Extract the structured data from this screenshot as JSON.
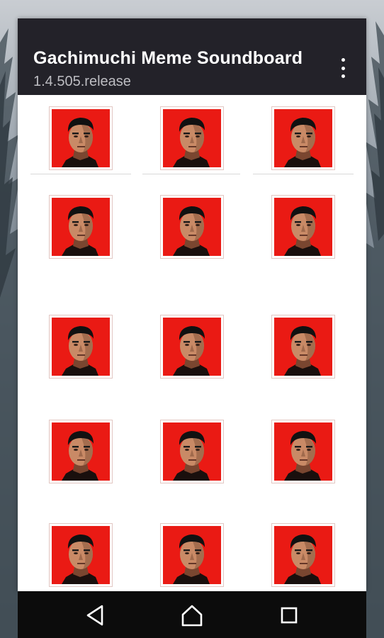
{
  "app": {
    "title": "Gachimuchi Meme Soundboard",
    "version": "1.4.505.release"
  },
  "menu": {
    "icon": "more-vert-icon"
  },
  "colors": {
    "appbar": "#232229",
    "tile_red": "#ea1a14",
    "navbar": "#0c0c0c"
  },
  "grid": {
    "columns": 3,
    "rows": 5,
    "tile_image": "portrait-face-on-red-icon"
  },
  "navigation": [
    {
      "name": "back",
      "icon": "back-triangle-icon"
    },
    {
      "name": "home",
      "icon": "home-icon"
    },
    {
      "name": "recents",
      "icon": "recents-square-icon"
    }
  ]
}
